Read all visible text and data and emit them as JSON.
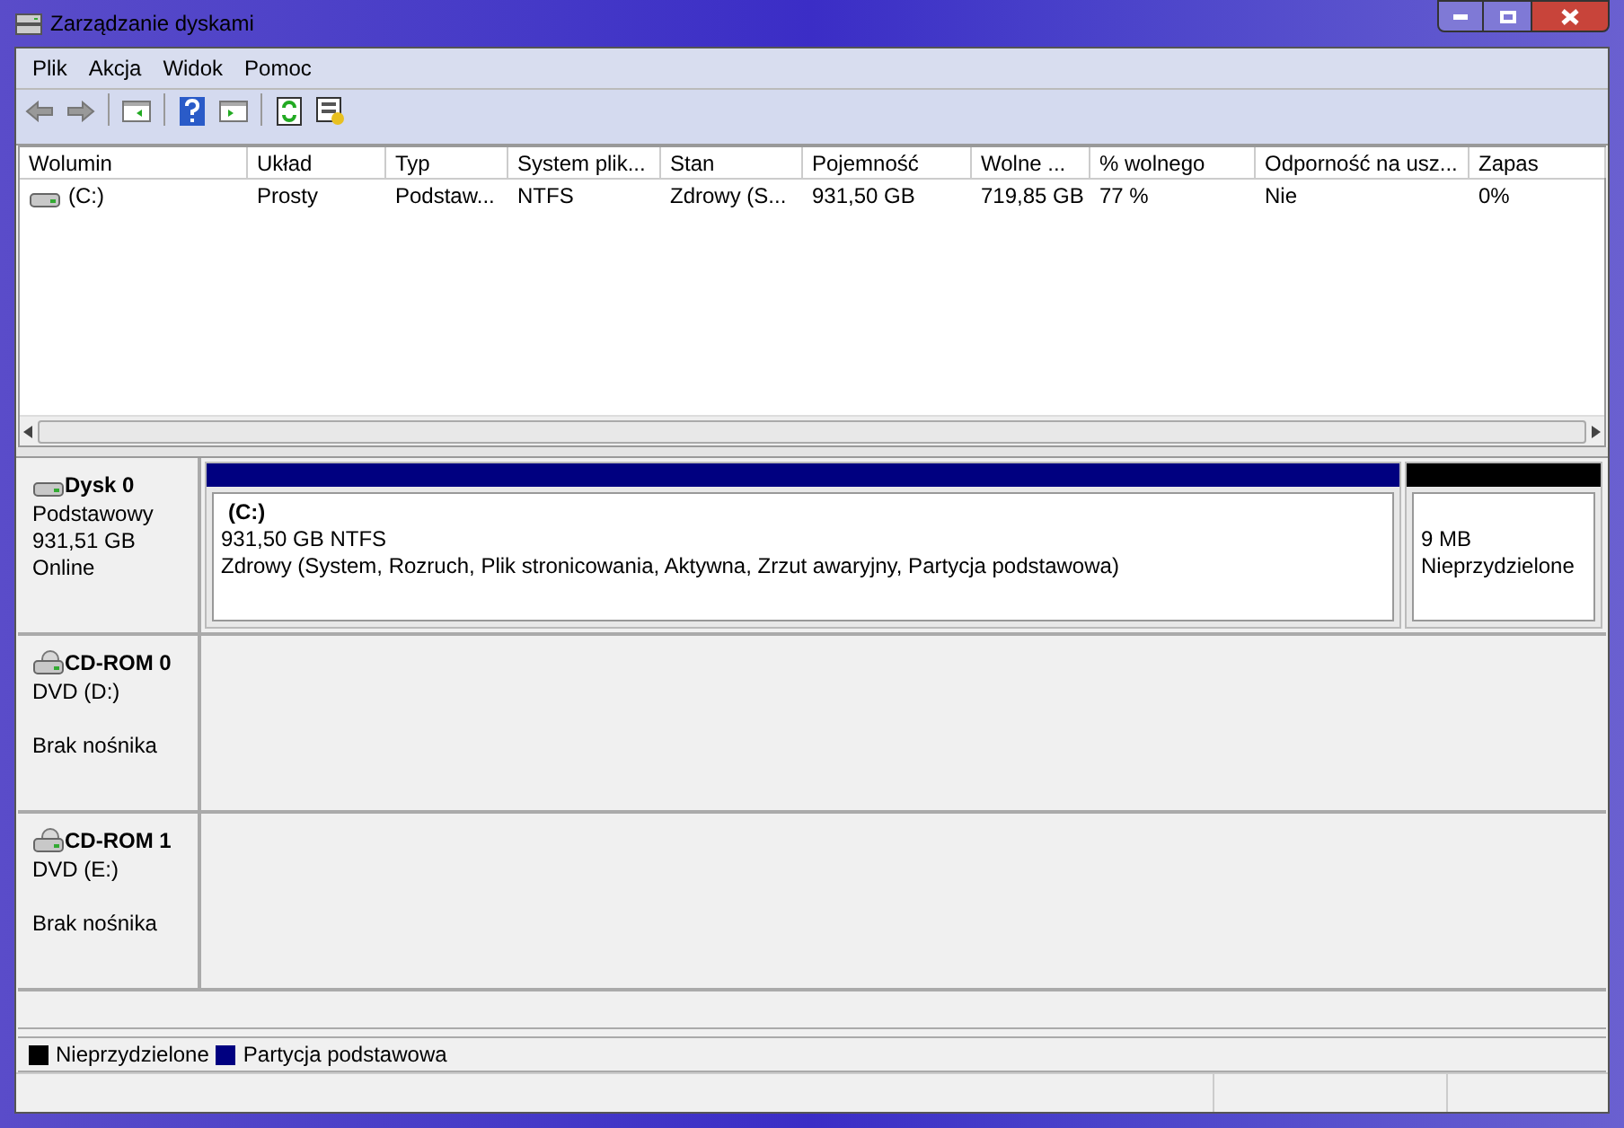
{
  "window": {
    "title": "Zarządzanie dyskami"
  },
  "menu": [
    "Plik",
    "Akcja",
    "Widok",
    "Pomoc"
  ],
  "table": {
    "columns": [
      "Wolumin",
      "Układ",
      "Typ",
      "System plik...",
      "Stan",
      "Pojemność",
      "Wolne ...",
      "% wolnego",
      "Odporność na usz...",
      "Zapas"
    ],
    "rows": [
      [
        "(C:)",
        "Prosty",
        "Podstaw...",
        "NTFS",
        "Zdrowy (S...",
        "931,50 GB",
        "719,85 GB",
        "77 %",
        "Nie",
        "0%"
      ]
    ]
  },
  "disks": [
    {
      "kind": "disk",
      "name": "Dysk 0",
      "lines": [
        "Podstawowy",
        "931,51 GB",
        "Online"
      ],
      "partitions": [
        {
          "kind": "primary",
          "title": "(C:)",
          "lines": [
            "931,50 GB NTFS",
            "Zdrowy (System, Rozruch, Plik stronicowania, Aktywna, Zrzut awaryjny, Partycja podstawowa)"
          ],
          "color": "#000080"
        },
        {
          "kind": "unallocated",
          "lines": [
            "9 MB",
            "Nieprzydzielone"
          ],
          "color": "#000000"
        }
      ]
    },
    {
      "kind": "cdrom",
      "name": "CD-ROM 0",
      "lines": [
        "DVD (D:)",
        "Brak nośnika"
      ]
    },
    {
      "kind": "cdrom",
      "name": "CD-ROM 1",
      "lines": [
        "DVD (E:)",
        "Brak nośnika"
      ]
    }
  ],
  "legend": [
    {
      "label": "Nieprzydzielone",
      "color": "#000000"
    },
    {
      "label": "Partycja podstawowa",
      "color": "#000080"
    }
  ]
}
